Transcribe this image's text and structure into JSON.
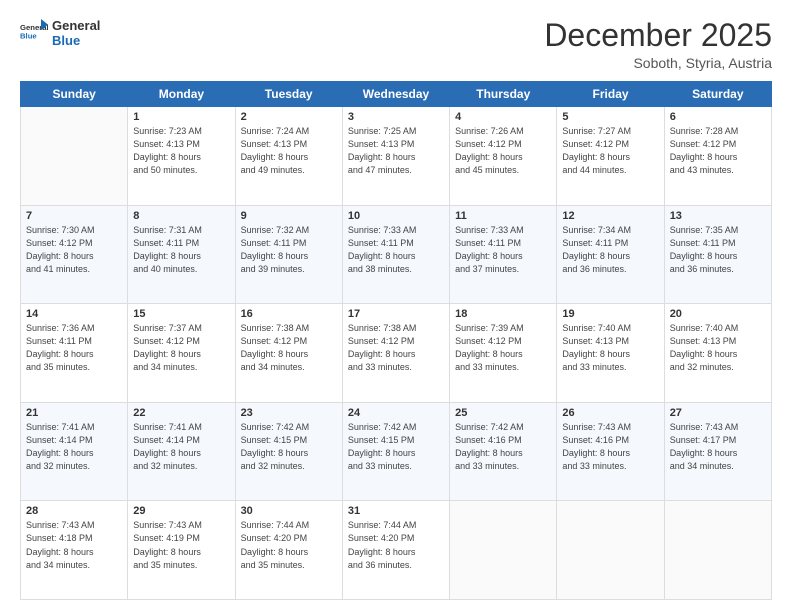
{
  "header": {
    "logo_line1": "General",
    "logo_line2": "Blue",
    "month": "December 2025",
    "location": "Soboth, Styria, Austria"
  },
  "weekdays": [
    "Sunday",
    "Monday",
    "Tuesday",
    "Wednesday",
    "Thursday",
    "Friday",
    "Saturday"
  ],
  "weeks": [
    [
      {
        "day": "",
        "info": ""
      },
      {
        "day": "1",
        "info": "Sunrise: 7:23 AM\nSunset: 4:13 PM\nDaylight: 8 hours\nand 50 minutes."
      },
      {
        "day": "2",
        "info": "Sunrise: 7:24 AM\nSunset: 4:13 PM\nDaylight: 8 hours\nand 49 minutes."
      },
      {
        "day": "3",
        "info": "Sunrise: 7:25 AM\nSunset: 4:13 PM\nDaylight: 8 hours\nand 47 minutes."
      },
      {
        "day": "4",
        "info": "Sunrise: 7:26 AM\nSunset: 4:12 PM\nDaylight: 8 hours\nand 45 minutes."
      },
      {
        "day": "5",
        "info": "Sunrise: 7:27 AM\nSunset: 4:12 PM\nDaylight: 8 hours\nand 44 minutes."
      },
      {
        "day": "6",
        "info": "Sunrise: 7:28 AM\nSunset: 4:12 PM\nDaylight: 8 hours\nand 43 minutes."
      }
    ],
    [
      {
        "day": "7",
        "info": "Sunrise: 7:30 AM\nSunset: 4:12 PM\nDaylight: 8 hours\nand 41 minutes."
      },
      {
        "day": "8",
        "info": "Sunrise: 7:31 AM\nSunset: 4:11 PM\nDaylight: 8 hours\nand 40 minutes."
      },
      {
        "day": "9",
        "info": "Sunrise: 7:32 AM\nSunset: 4:11 PM\nDaylight: 8 hours\nand 39 minutes."
      },
      {
        "day": "10",
        "info": "Sunrise: 7:33 AM\nSunset: 4:11 PM\nDaylight: 8 hours\nand 38 minutes."
      },
      {
        "day": "11",
        "info": "Sunrise: 7:33 AM\nSunset: 4:11 PM\nDaylight: 8 hours\nand 37 minutes."
      },
      {
        "day": "12",
        "info": "Sunrise: 7:34 AM\nSunset: 4:11 PM\nDaylight: 8 hours\nand 36 minutes."
      },
      {
        "day": "13",
        "info": "Sunrise: 7:35 AM\nSunset: 4:11 PM\nDaylight: 8 hours\nand 36 minutes."
      }
    ],
    [
      {
        "day": "14",
        "info": "Sunrise: 7:36 AM\nSunset: 4:11 PM\nDaylight: 8 hours\nand 35 minutes."
      },
      {
        "day": "15",
        "info": "Sunrise: 7:37 AM\nSunset: 4:12 PM\nDaylight: 8 hours\nand 34 minutes."
      },
      {
        "day": "16",
        "info": "Sunrise: 7:38 AM\nSunset: 4:12 PM\nDaylight: 8 hours\nand 34 minutes."
      },
      {
        "day": "17",
        "info": "Sunrise: 7:38 AM\nSunset: 4:12 PM\nDaylight: 8 hours\nand 33 minutes."
      },
      {
        "day": "18",
        "info": "Sunrise: 7:39 AM\nSunset: 4:12 PM\nDaylight: 8 hours\nand 33 minutes."
      },
      {
        "day": "19",
        "info": "Sunrise: 7:40 AM\nSunset: 4:13 PM\nDaylight: 8 hours\nand 33 minutes."
      },
      {
        "day": "20",
        "info": "Sunrise: 7:40 AM\nSunset: 4:13 PM\nDaylight: 8 hours\nand 32 minutes."
      }
    ],
    [
      {
        "day": "21",
        "info": "Sunrise: 7:41 AM\nSunset: 4:14 PM\nDaylight: 8 hours\nand 32 minutes."
      },
      {
        "day": "22",
        "info": "Sunrise: 7:41 AM\nSunset: 4:14 PM\nDaylight: 8 hours\nand 32 minutes."
      },
      {
        "day": "23",
        "info": "Sunrise: 7:42 AM\nSunset: 4:15 PM\nDaylight: 8 hours\nand 32 minutes."
      },
      {
        "day": "24",
        "info": "Sunrise: 7:42 AM\nSunset: 4:15 PM\nDaylight: 8 hours\nand 33 minutes."
      },
      {
        "day": "25",
        "info": "Sunrise: 7:42 AM\nSunset: 4:16 PM\nDaylight: 8 hours\nand 33 minutes."
      },
      {
        "day": "26",
        "info": "Sunrise: 7:43 AM\nSunset: 4:16 PM\nDaylight: 8 hours\nand 33 minutes."
      },
      {
        "day": "27",
        "info": "Sunrise: 7:43 AM\nSunset: 4:17 PM\nDaylight: 8 hours\nand 34 minutes."
      }
    ],
    [
      {
        "day": "28",
        "info": "Sunrise: 7:43 AM\nSunset: 4:18 PM\nDaylight: 8 hours\nand 34 minutes."
      },
      {
        "day": "29",
        "info": "Sunrise: 7:43 AM\nSunset: 4:19 PM\nDaylight: 8 hours\nand 35 minutes."
      },
      {
        "day": "30",
        "info": "Sunrise: 7:44 AM\nSunset: 4:20 PM\nDaylight: 8 hours\nand 35 minutes."
      },
      {
        "day": "31",
        "info": "Sunrise: 7:44 AM\nSunset: 4:20 PM\nDaylight: 8 hours\nand 36 minutes."
      },
      {
        "day": "",
        "info": ""
      },
      {
        "day": "",
        "info": ""
      },
      {
        "day": "",
        "info": ""
      }
    ]
  ]
}
